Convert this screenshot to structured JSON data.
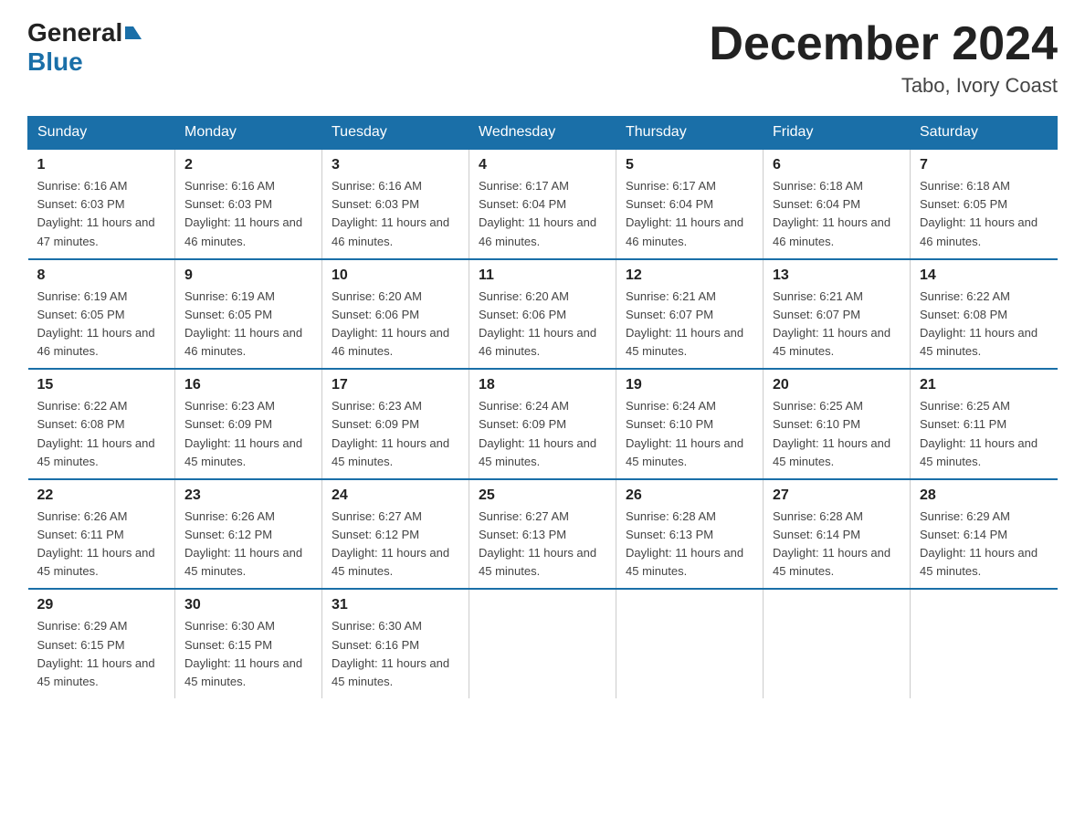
{
  "logo": {
    "general": "General",
    "blue": "Blue",
    "triangle": "▲"
  },
  "header": {
    "month": "December 2024",
    "location": "Tabo, Ivory Coast"
  },
  "weekdays": [
    "Sunday",
    "Monday",
    "Tuesday",
    "Wednesday",
    "Thursday",
    "Friday",
    "Saturday"
  ],
  "weeks": [
    [
      {
        "day": "1",
        "sunrise": "6:16 AM",
        "sunset": "6:03 PM",
        "daylight": "11 hours and 47 minutes."
      },
      {
        "day": "2",
        "sunrise": "6:16 AM",
        "sunset": "6:03 PM",
        "daylight": "11 hours and 46 minutes."
      },
      {
        "day": "3",
        "sunrise": "6:16 AM",
        "sunset": "6:03 PM",
        "daylight": "11 hours and 46 minutes."
      },
      {
        "day": "4",
        "sunrise": "6:17 AM",
        "sunset": "6:04 PM",
        "daylight": "11 hours and 46 minutes."
      },
      {
        "day": "5",
        "sunrise": "6:17 AM",
        "sunset": "6:04 PM",
        "daylight": "11 hours and 46 minutes."
      },
      {
        "day": "6",
        "sunrise": "6:18 AM",
        "sunset": "6:04 PM",
        "daylight": "11 hours and 46 minutes."
      },
      {
        "day": "7",
        "sunrise": "6:18 AM",
        "sunset": "6:05 PM",
        "daylight": "11 hours and 46 minutes."
      }
    ],
    [
      {
        "day": "8",
        "sunrise": "6:19 AM",
        "sunset": "6:05 PM",
        "daylight": "11 hours and 46 minutes."
      },
      {
        "day": "9",
        "sunrise": "6:19 AM",
        "sunset": "6:05 PM",
        "daylight": "11 hours and 46 minutes."
      },
      {
        "day": "10",
        "sunrise": "6:20 AM",
        "sunset": "6:06 PM",
        "daylight": "11 hours and 46 minutes."
      },
      {
        "day": "11",
        "sunrise": "6:20 AM",
        "sunset": "6:06 PM",
        "daylight": "11 hours and 46 minutes."
      },
      {
        "day": "12",
        "sunrise": "6:21 AM",
        "sunset": "6:07 PM",
        "daylight": "11 hours and 45 minutes."
      },
      {
        "day": "13",
        "sunrise": "6:21 AM",
        "sunset": "6:07 PM",
        "daylight": "11 hours and 45 minutes."
      },
      {
        "day": "14",
        "sunrise": "6:22 AM",
        "sunset": "6:08 PM",
        "daylight": "11 hours and 45 minutes."
      }
    ],
    [
      {
        "day": "15",
        "sunrise": "6:22 AM",
        "sunset": "6:08 PM",
        "daylight": "11 hours and 45 minutes."
      },
      {
        "day": "16",
        "sunrise": "6:23 AM",
        "sunset": "6:09 PM",
        "daylight": "11 hours and 45 minutes."
      },
      {
        "day": "17",
        "sunrise": "6:23 AM",
        "sunset": "6:09 PM",
        "daylight": "11 hours and 45 minutes."
      },
      {
        "day": "18",
        "sunrise": "6:24 AM",
        "sunset": "6:09 PM",
        "daylight": "11 hours and 45 minutes."
      },
      {
        "day": "19",
        "sunrise": "6:24 AM",
        "sunset": "6:10 PM",
        "daylight": "11 hours and 45 minutes."
      },
      {
        "day": "20",
        "sunrise": "6:25 AM",
        "sunset": "6:10 PM",
        "daylight": "11 hours and 45 minutes."
      },
      {
        "day": "21",
        "sunrise": "6:25 AM",
        "sunset": "6:11 PM",
        "daylight": "11 hours and 45 minutes."
      }
    ],
    [
      {
        "day": "22",
        "sunrise": "6:26 AM",
        "sunset": "6:11 PM",
        "daylight": "11 hours and 45 minutes."
      },
      {
        "day": "23",
        "sunrise": "6:26 AM",
        "sunset": "6:12 PM",
        "daylight": "11 hours and 45 minutes."
      },
      {
        "day": "24",
        "sunrise": "6:27 AM",
        "sunset": "6:12 PM",
        "daylight": "11 hours and 45 minutes."
      },
      {
        "day": "25",
        "sunrise": "6:27 AM",
        "sunset": "6:13 PM",
        "daylight": "11 hours and 45 minutes."
      },
      {
        "day": "26",
        "sunrise": "6:28 AM",
        "sunset": "6:13 PM",
        "daylight": "11 hours and 45 minutes."
      },
      {
        "day": "27",
        "sunrise": "6:28 AM",
        "sunset": "6:14 PM",
        "daylight": "11 hours and 45 minutes."
      },
      {
        "day": "28",
        "sunrise": "6:29 AM",
        "sunset": "6:14 PM",
        "daylight": "11 hours and 45 minutes."
      }
    ],
    [
      {
        "day": "29",
        "sunrise": "6:29 AM",
        "sunset": "6:15 PM",
        "daylight": "11 hours and 45 minutes."
      },
      {
        "day": "30",
        "sunrise": "6:30 AM",
        "sunset": "6:15 PM",
        "daylight": "11 hours and 45 minutes."
      },
      {
        "day": "31",
        "sunrise": "6:30 AM",
        "sunset": "6:16 PM",
        "daylight": "11 hours and 45 minutes."
      },
      null,
      null,
      null,
      null
    ]
  ]
}
